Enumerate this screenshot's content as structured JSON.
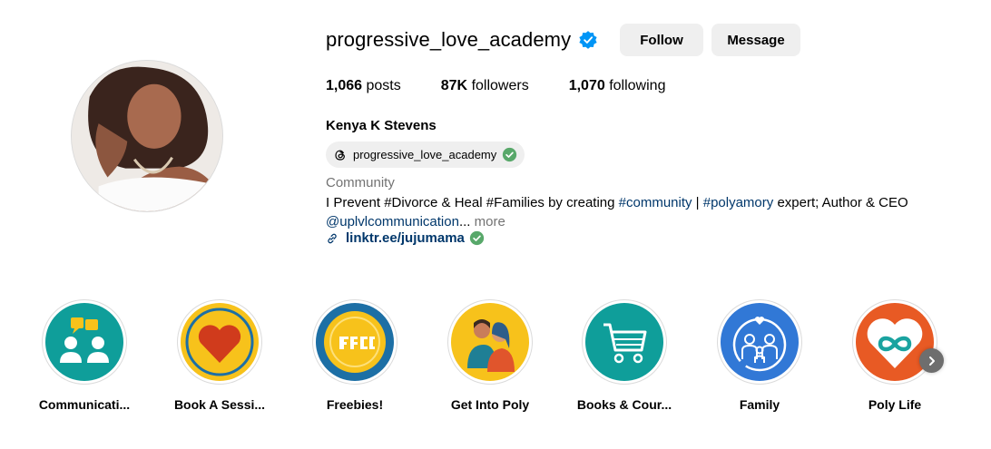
{
  "profile": {
    "username": "progressive_love_academy",
    "verified_icon": "verified-badge-icon",
    "follow_label": "Follow",
    "message_label": "Message",
    "stats": {
      "posts_count": "1,066",
      "posts_label": "posts",
      "followers_count": "87K",
      "followers_label": "followers",
      "following_count": "1,070",
      "following_label": "following"
    },
    "full_name": "Kenya K Stevens",
    "threads_handle": "progressive_love_academy",
    "category": "Community",
    "bio": {
      "text_1": "I Prevent #Divorce & Heal #Families by creating ",
      "tag_community": "#community",
      "text_2": " | ",
      "tag_polyamory": "#polyamory",
      "text_3": " expert; Author & CEO",
      "mention": "@uplvlcommunication",
      "ellipsis": "...",
      "more_label": " more"
    },
    "link": "linktr.ee/jujumama"
  },
  "highlights": [
    {
      "label": "Communicati...",
      "icon": "communication-icon",
      "color": "#0f9e9a"
    },
    {
      "label": "Book A Sessi...",
      "icon": "heart-icon",
      "color": "#f7c21b"
    },
    {
      "label": "Freebies!",
      "icon": "free-badge-icon",
      "color": "#1d6fa5"
    },
    {
      "label": "Get Into Poly",
      "icon": "couple-icon",
      "color": "#f7c21b"
    },
    {
      "label": "Books & Cour...",
      "icon": "shopping-cart-icon",
      "color": "#0f9e9a"
    },
    {
      "label": "Family",
      "icon": "family-icon",
      "color": "#3178d6"
    },
    {
      "label": "Poly Life",
      "icon": "infinity-heart-icon",
      "color": "#e85a24"
    }
  ],
  "colors": {
    "link": "#00376b",
    "verified": "#0095f6",
    "button_bg": "#efefef",
    "muted": "#737373"
  }
}
